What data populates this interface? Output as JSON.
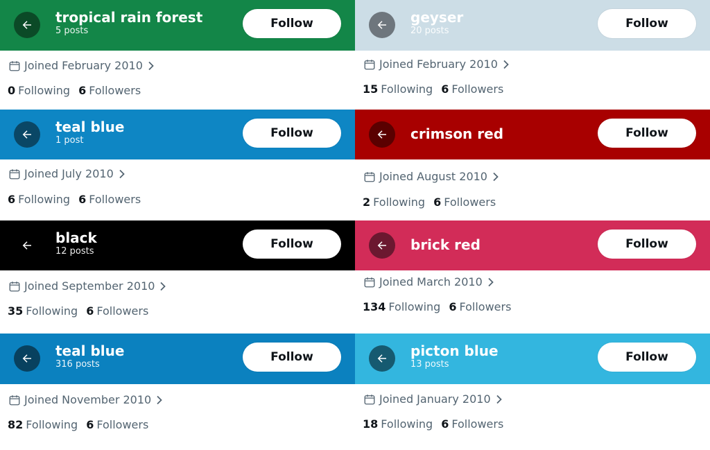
{
  "profiles": [
    {
      "name": "tropical rain forest",
      "posts": "5 posts",
      "banner_color": "#138648",
      "back_bg": "#0b4a27",
      "follow_label": "Follow",
      "joined": "Joined February 2010",
      "following_count": "0",
      "following_label": "Following",
      "followers_count": "6",
      "followers_label": "Followers"
    },
    {
      "name": "geyser",
      "posts": "20 posts",
      "banner_color": "#ccdde6",
      "back_bg": "#6e767d",
      "follow_label": "Follow",
      "joined": "Joined February 2010",
      "following_count": "15",
      "following_label": "Following",
      "followers_count": "6",
      "followers_label": "Followers"
    },
    {
      "name": "teal blue",
      "posts": "1 post",
      "banner_color": "#0e86c4",
      "back_bg": "#0a4766",
      "follow_label": "Follow",
      "joined": "Joined July 2010",
      "following_count": "6",
      "following_label": "Following",
      "followers_count": "6",
      "followers_label": "Followers"
    },
    {
      "name": "crimson red",
      "posts": "",
      "banner_color": "#a80000",
      "back_bg": "#5a0000",
      "follow_label": "Follow",
      "joined": "Joined August 2010",
      "following_count": "2",
      "following_label": "Following",
      "followers_count": "6",
      "followers_label": "Followers"
    },
    {
      "name": "black",
      "posts": "12 posts",
      "banner_color": "#000000",
      "back_bg": "#000000",
      "follow_label": "Follow",
      "joined": "Joined September 2010",
      "following_count": "35",
      "following_label": "Following",
      "followers_count": "6",
      "followers_label": "Followers"
    },
    {
      "name": "brick red",
      "posts": "",
      "banner_color": "#d22c58",
      "back_bg": "#6b1830",
      "follow_label": "Follow",
      "joined": "Joined March 2010",
      "following_count": "134",
      "following_label": "Following",
      "followers_count": "6",
      "followers_label": "Followers"
    },
    {
      "name": "teal blue",
      "posts": "316 posts",
      "banner_color": "#0b81bf",
      "back_bg": "#08415f",
      "follow_label": "Follow",
      "joined": "Joined November 2010",
      "following_count": "82",
      "following_label": "Following",
      "followers_count": "6",
      "followers_label": "Followers"
    },
    {
      "name": "picton blue",
      "posts": "13 posts",
      "banner_color": "#33b6df",
      "back_bg": "#165a70",
      "follow_label": "Follow",
      "joined": "Joined January 2010",
      "following_count": "18",
      "following_label": "Following",
      "followers_count": "6",
      "followers_label": "Followers"
    }
  ],
  "icons": {
    "back": "back-arrow-icon",
    "calendar": "calendar-icon",
    "chevron": "chevron-right-icon"
  },
  "colors": {
    "text_primary": "#0f1419",
    "text_secondary": "#536471",
    "follow_button_bg": "#ffffff"
  }
}
